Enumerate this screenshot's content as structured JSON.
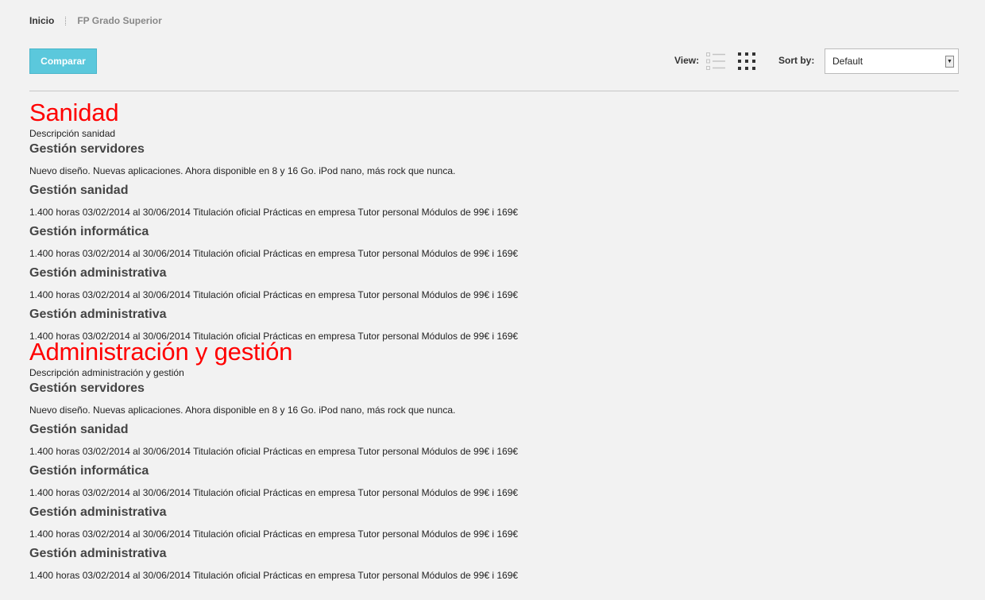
{
  "breadcrumb": {
    "home": "Inicio",
    "current": "FP Grado Superior"
  },
  "toolbar": {
    "compare_label": "Comparar",
    "view_label": "View:",
    "view_icons": [
      "list-view-icon",
      "grid-view-icon"
    ],
    "sort_label": "Sort by:",
    "sort_value": "Default"
  },
  "colors": {
    "category_title": "#ff0000",
    "button": "#5bc8dc",
    "background": "#f2f2f2"
  },
  "categories": [
    {
      "title": "Sanidad",
      "description": "Descripción sanidad",
      "courses": [
        {
          "title": "Gestión servidores",
          "description": "Nuevo diseño. Nuevas aplicaciones. Ahora disponible en 8 y 16 Go. iPod nano, más rock que nunca."
        },
        {
          "title": "Gestión sanidad",
          "description": "1.400 horas 03/02/2014 al 30/06/2014 Titulación oficial Prácticas en empresa Tutor personal Módulos de 99€ i 169€"
        },
        {
          "title": "Gestión informática",
          "description": "1.400 horas 03/02/2014 al 30/06/2014 Titulación oficial Prácticas en empresa Tutor personal Módulos de 99€ i 169€"
        },
        {
          "title": "Gestión administrativa",
          "description": "1.400 horas 03/02/2014 al 30/06/2014 Titulación oficial Prácticas en empresa Tutor personal Módulos de 99€ i 169€"
        },
        {
          "title": "Gestión administrativa",
          "description": "1.400 horas 03/02/2014 al 30/06/2014 Titulación oficial Prácticas en empresa Tutor personal Módulos de 99€ i 169€"
        }
      ]
    },
    {
      "title": "Administración y gestión",
      "description": "Descripción administración y gestión",
      "courses": [
        {
          "title": "Gestión servidores",
          "description": "Nuevo diseño. Nuevas aplicaciones. Ahora disponible en 8 y 16 Go. iPod nano, más rock que nunca."
        },
        {
          "title": "Gestión sanidad",
          "description": "1.400 horas 03/02/2014 al 30/06/2014 Titulación oficial Prácticas en empresa Tutor personal Módulos de 99€ i 169€"
        },
        {
          "title": "Gestión informática",
          "description": "1.400 horas 03/02/2014 al 30/06/2014 Titulación oficial Prácticas en empresa Tutor personal Módulos de 99€ i 169€"
        },
        {
          "title": "Gestión administrativa",
          "description": "1.400 horas 03/02/2014 al 30/06/2014 Titulación oficial Prácticas en empresa Tutor personal Módulos de 99€ i 169€"
        },
        {
          "title": "Gestión administrativa",
          "description": "1.400 horas 03/02/2014 al 30/06/2014 Titulación oficial Prácticas en empresa Tutor personal Módulos de 99€ i 169€"
        }
      ]
    }
  ]
}
